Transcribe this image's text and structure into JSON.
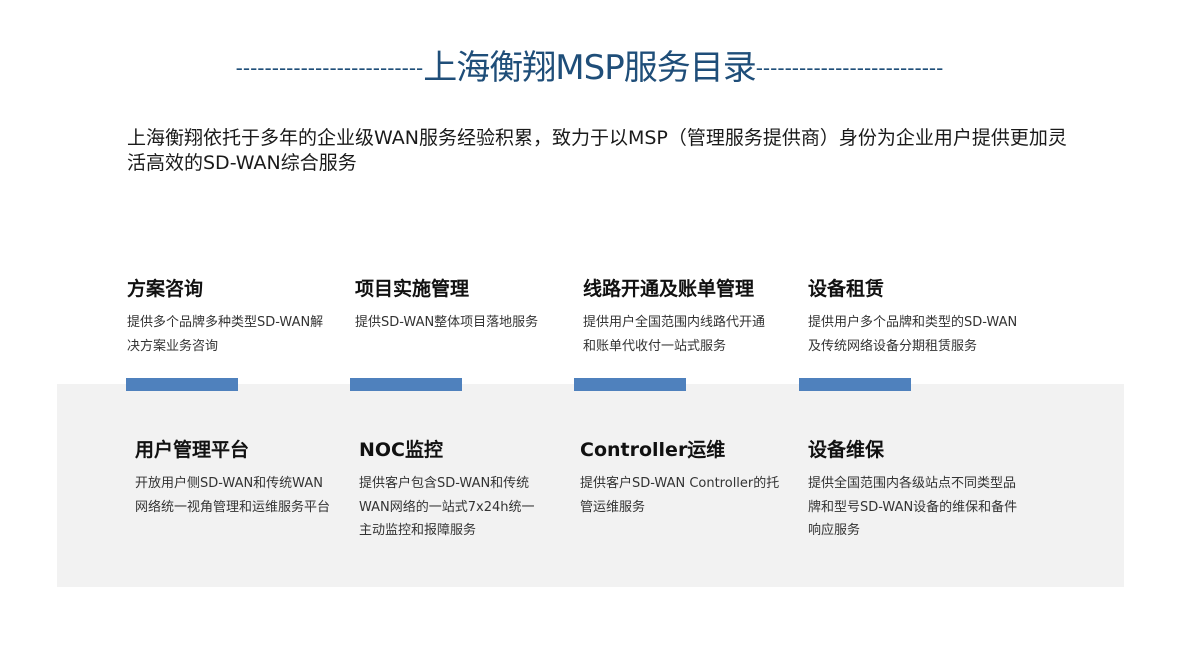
{
  "header": {
    "title": "上海衡翔MSP服务目录",
    "left_dashes": "--------------------------",
    "right_dashes": "--------------------------"
  },
  "intro": {
    "text": "上海衡翔依托于多年的企业级WAN服务经验积累，致力于以MSP（管理服务提供商）身份为企业用户提供更加灵活高效的SD-WAN综合服务"
  },
  "services_top": [
    {
      "title": "方案咨询",
      "desc": "提供多个品牌多种类型SD-WAN解决方案业务咨询"
    },
    {
      "title": "项目实施管理",
      "desc": "提供SD-WAN整体项目落地服务"
    },
    {
      "title": "线路开通及账单管理",
      "desc": "提供用户全国范围内线路代开通和账单代收付一站式服务"
    },
    {
      "title": "设备租赁",
      "desc": "提供用户多个品牌和类型的SD-WAN及传统网络设备分期租赁服务"
    }
  ],
  "services_bottom": [
    {
      "title": "用户管理平台",
      "desc": "开放用户侧SD-WAN和传统WAN网络统一视角管理和运维服务平台"
    },
    {
      "title": "NOC监控",
      "desc": "提供客户包含SD-WAN和传统WAN网络的一站式7x24h统一主动监控和报障服务"
    },
    {
      "title": "Controller运维",
      "desc": "提供客户SD-WAN Controller的托管运维服务"
    },
    {
      "title": "设备维保",
      "desc": "提供全国范围内各级站点不同类型品牌和型号SD-WAN设备的维保和备件响应服务"
    }
  ],
  "colors": {
    "title": "#1f4e79",
    "accent_bar": "#4f81bd",
    "panel_bg": "#f2f2f2"
  }
}
